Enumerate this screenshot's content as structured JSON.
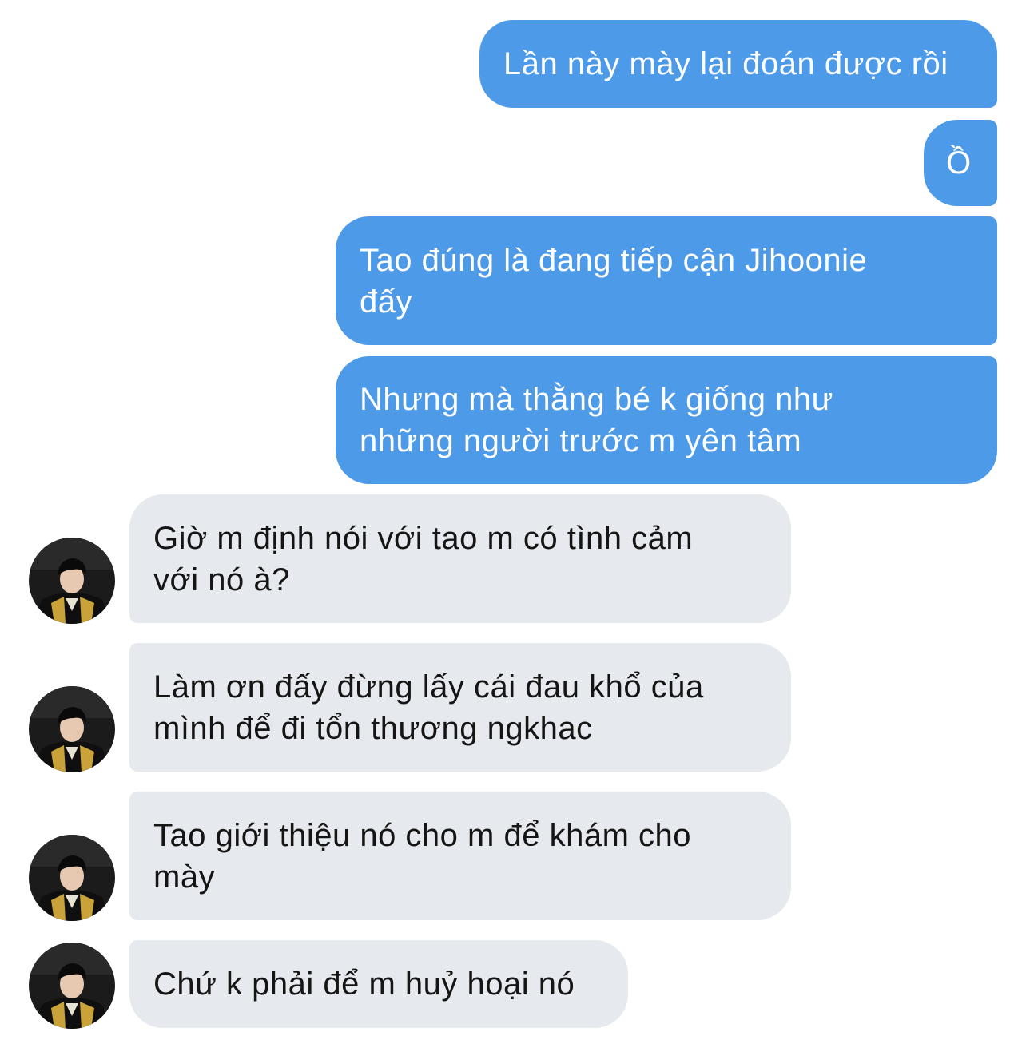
{
  "conversation": {
    "sent_messages": [
      "Lần này mày lại đoán được rồi",
      "Ồ",
      "Tao đúng là đang tiếp cận Jihoonie\nđấy",
      "Nhưng mà thằng bé k giống như\nnhững người trước m yên tâm"
    ],
    "received_messages": [
      "Giờ m định nói với tao m có tình cảm\nvới nó à?",
      "Làm ơn đấy đừng lấy cái đau khổ của\nmình để đi tổn thương ngkhac",
      "Tao giới thiệu nó cho m để khám cho\nmày",
      "Chứ k phải để m huỷ hoại nó"
    ],
    "contact_avatar": "profile-photo"
  },
  "colors": {
    "sent_bubble": "#4d9be8",
    "received_bubble": "#e6e9ed",
    "background": "#ffffff"
  }
}
